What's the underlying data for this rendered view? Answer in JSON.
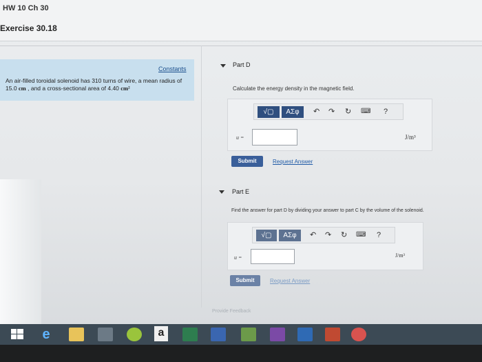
{
  "header": {
    "course": "HW 10 Ch 30",
    "exercise": "Exercise 30.18"
  },
  "problem": {
    "constants_link": "Constants",
    "text_1": "An air-filled toroidal solenoid has 310 turns of wire, a mean radius of 15.0 ",
    "unit_cm": "cm",
    "text_2": " , and a cross-sectional area of 4.40 ",
    "unit_cm2": "cm²"
  },
  "part_d": {
    "label": "Part D",
    "prompt": "Calculate the energy density in the magnetic field.",
    "toolbar": {
      "template_label": "√▢",
      "greek_label": "ΑΣφ",
      "undo_icon": "undo-icon",
      "redo_icon": "redo-icon",
      "reset_icon": "reset-icon",
      "keyboard_icon": "keyboard-icon",
      "help_label": "?"
    },
    "variable": "u =",
    "input_value": "",
    "unit": "J/m³",
    "submit_label": "Submit",
    "request_label": "Request Answer"
  },
  "part_e": {
    "label": "Part E",
    "prompt": "Find the answer for part D by dividing your answer to part C by the volume of the solenoid.",
    "toolbar": {
      "template_label": "√▢",
      "greek_label": "ΑΣφ",
      "help_label": "?"
    },
    "variable": "u =",
    "input_value": "",
    "unit": "J/m³",
    "submit_label": "Submit",
    "request_label": "Request Answer"
  },
  "footer": {
    "feedback_label": "Provide Feedback"
  },
  "taskbar": {
    "amazon_label": "a",
    "apps": [
      "start",
      "edge",
      "file-explorer",
      "store",
      "spotify",
      "amazon",
      "excel",
      "word",
      "minecraft",
      "onenote",
      "outlook",
      "powerpoint",
      "chrome"
    ]
  },
  "colors": {
    "button_blue": "#2f4f7f",
    "link_blue": "#1f5aa6",
    "constants_bg": "#c8dfee"
  }
}
